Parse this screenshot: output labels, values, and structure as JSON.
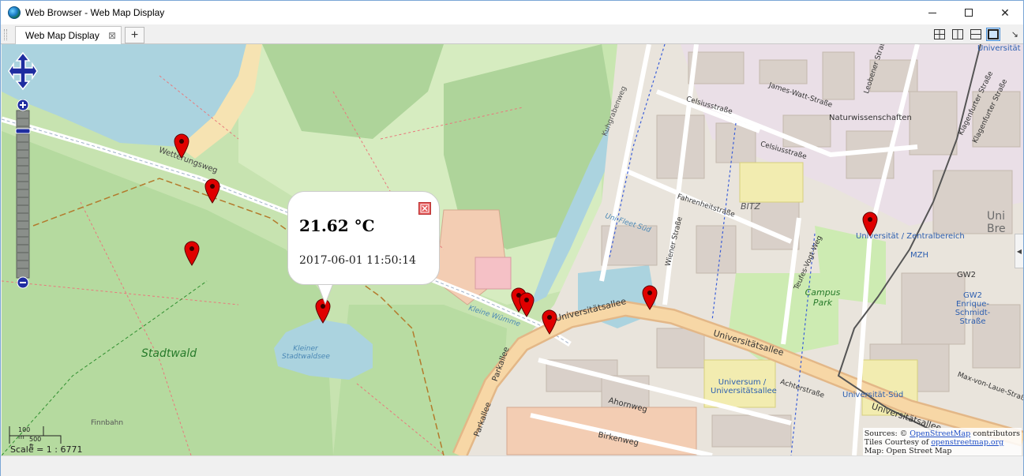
{
  "window": {
    "title": "Web Browser - Web Map Display",
    "minimize_icon": "minimize-icon",
    "maximize_icon": "maximize-icon",
    "close_glyph": "✕"
  },
  "tabs": {
    "items": [
      {
        "label": "Web Map Display",
        "close_glyph": "⊠"
      }
    ],
    "add_glyph": "+",
    "layout_icons": [
      "grid-2x2-icon",
      "split-vertical-icon",
      "split-horizontal-icon",
      "single-pane-icon"
    ],
    "menu_glyph": "↘"
  },
  "map": {
    "popup": {
      "temperature": "21.62 °C",
      "timestamp": "2017-06-01 11:50:14",
      "close_icon": "close-popup-icon"
    },
    "marker_color": "#e00000",
    "marker_count": 9,
    "labels": {
      "wetterungsweg": "Wetterungsweg",
      "stadtwald": "Stadtwald",
      "kleiner_stadtwaldsee": "Kleiner Stadtwaldsee",
      "kleine_wumme": "Kleine Wümme",
      "universitatsallee": "Universitätsallee",
      "universitatsallee_2": "Universitätsallee",
      "universitatsallee_3": "Universitätsallee",
      "parkallee": "Parkallee",
      "parkallee_2": "Parkallee",
      "ahornweg": "Ahornweg",
      "birkenweg": "Birkenweg",
      "finnbahn": "Finnbahn",
      "kuhgrabenweg": "Kuhgrabenweg",
      "celsiusstrasse": "Celsiusstraße",
      "celsiusstrasse_2": "Celsiusstraße",
      "james_watt": "James-Watt-Straße",
      "leobener": "Leobener Straße",
      "naturwissenschaften": "Naturwissenschaften",
      "klagenfurter": "Klagenfurter Straße",
      "klagenfurter_2": "Klagenfurter Straße",
      "fahrenheitstrasse": "Fahrenheitstraße",
      "bitz": "BITZ",
      "wiener": "Wiener Straße",
      "enrique_schmidt": "Enrique-Schmidt-Straße",
      "uni_fleet_sud": "Uni-Fleet Süd",
      "tettes_vogt": "Teufes-Vogt-Weg",
      "campus_park": "Campus Park",
      "gw2": "GW2",
      "gw2_block": "GW2 Enrique-Schmidt-Straße",
      "uni_zentral": "Universität / Zentralbereich",
      "mzh": "MZH",
      "universum": "Universum / Universitätsallee",
      "achterstrasse": "Achterstraße",
      "universitat_sud": "Universität-Süd",
      "max_von_laue": "Max-von-Laue-Straße",
      "uni_bre": "Uni Bre",
      "universitat_top": "Universität"
    },
    "scale": {
      "meters": "100 m",
      "feet": "500 ft",
      "ratio": "Scale = 1 : 6771"
    },
    "attribution": {
      "line1_prefix": "Sources: ©",
      "line1_link": "OpenStreetMap",
      "line1_suffix": "contributors",
      "line2_prefix": "Tiles Courtesy of",
      "line2_link": "openstreetmap.org",
      "line3": "Map: Open Street Map"
    },
    "controls": {
      "pan_icon": "pan-arrows-icon",
      "zoom_in": "+",
      "zoom_out": "−"
    }
  }
}
